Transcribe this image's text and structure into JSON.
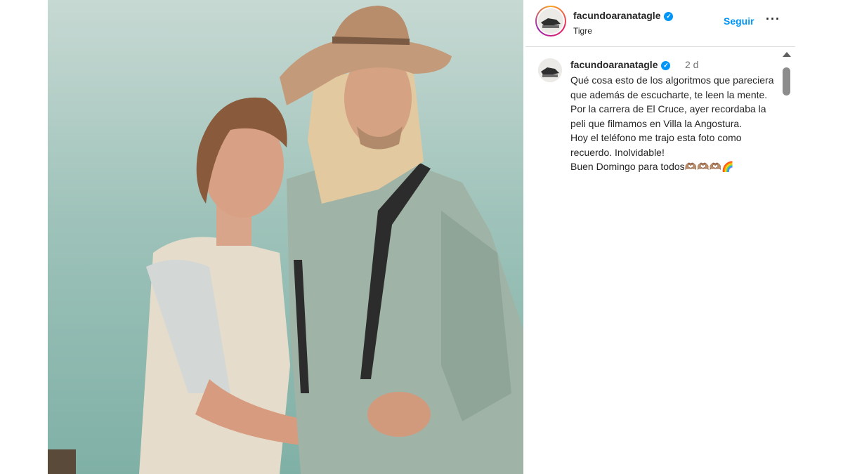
{
  "post": {
    "username": "facundoaranatagle",
    "location": "Tigre",
    "follow_label": "Seguir",
    "more_label": "···",
    "verified_glyph": "✓"
  },
  "caption": {
    "username": "facundoaranatagle",
    "time": "2 d",
    "lines": [
      "Qué cosa esto de los algoritmos que pareciera que además de escucharte, te leen la mente.",
      " Por la carrera de El Cruce, ayer recordaba la peli que filmamos en Villa la Angostura.",
      " Hoy el teléfono me trajo esta foto como recuerdo. Inolvidable!",
      " Buen Domingo para todos🫶🏽🫶🏽🫶🏽🌈"
    ]
  },
  "icons": {
    "verified": "verified-badge-icon",
    "more": "more-options-icon",
    "scroll_up": "scroll-up-arrow-icon"
  },
  "colors": {
    "link_blue": "#0095f6",
    "text": "#262626",
    "muted": "#737373",
    "divider": "#dbdbdb"
  }
}
